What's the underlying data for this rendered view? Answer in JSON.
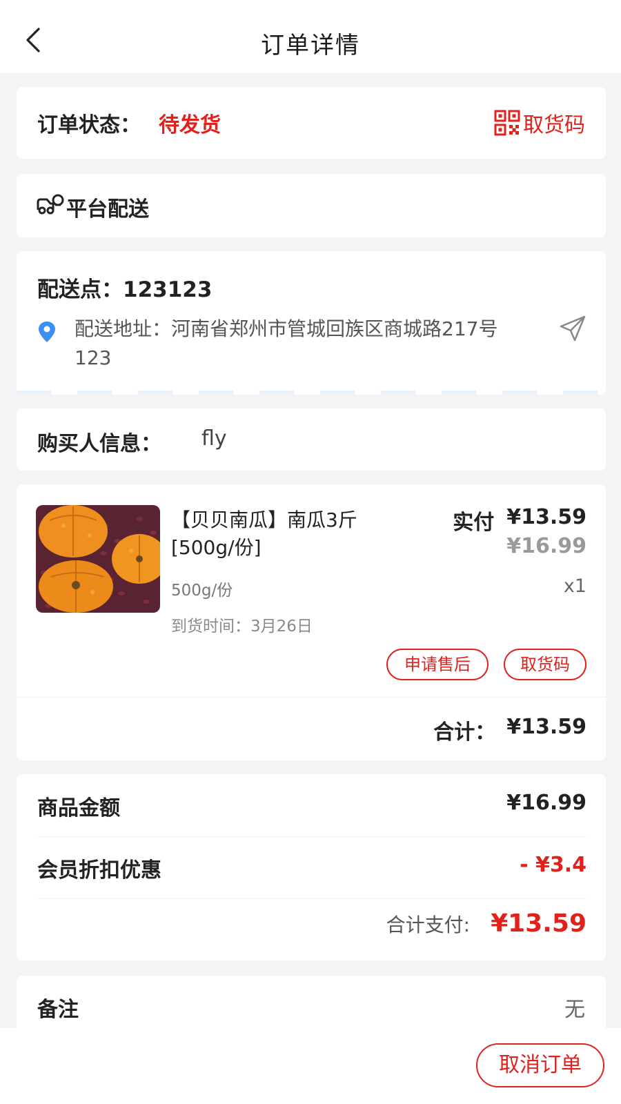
{
  "header": {
    "title": "订单详情",
    "back_icon": "chevron-left-icon"
  },
  "status": {
    "label": "订单状态：",
    "value": "待发货",
    "pickup_code_label": "取货码",
    "pickup_icon": "qr-code-icon",
    "accent": "#e0211c"
  },
  "delivery": {
    "label": "平台配送",
    "icon": "delivery-truck-icon"
  },
  "address": {
    "point_label": "配送点：",
    "point_value": "123123",
    "address_text": "配送地址：河南省郑州市管城回族区商城路217号123",
    "pin_icon": "location-pin-icon",
    "navigate_icon": "navigate-send-icon"
  },
  "buyer": {
    "label": "购买人信息：",
    "value": "fly"
  },
  "product": {
    "name": "【贝贝南瓜】南瓜3斤[500g/份]",
    "paid_label": "实付",
    "paid_price": "¥13.59",
    "original_price": "¥16.99",
    "spec": "500g/份",
    "quantity": "x1",
    "arrival_label": "到货时间：",
    "arrival_value": "3月26日",
    "after_sale_button": "申请售后",
    "pickup_code_button": "取货码",
    "total_label": "合计：",
    "total_value": "¥13.59"
  },
  "summary": {
    "goods_amount_label": "商品金额",
    "goods_amount_value": "¥16.99",
    "member_discount_label": "会员折扣优惠",
    "member_discount_value": "- ¥3.4",
    "pay_total_label": "合计支付:",
    "pay_total_value": "¥13.59"
  },
  "remark": {
    "label": "备注",
    "value": "无"
  },
  "footer": {
    "cancel_button": "取消订单"
  }
}
